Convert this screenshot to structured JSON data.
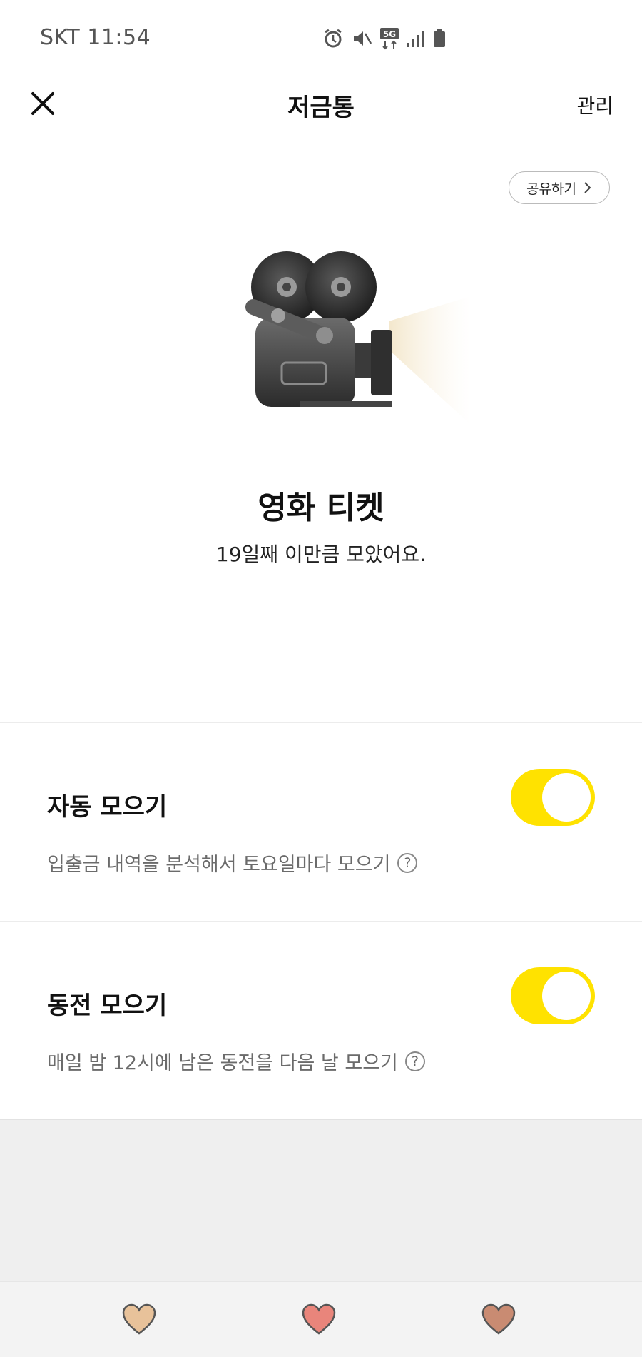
{
  "status_bar": {
    "carrier_time": "SKT 11:54",
    "network": "5G"
  },
  "header": {
    "title": "저금통",
    "manage_label": "관리"
  },
  "share": {
    "label": "공유하기"
  },
  "goal": {
    "name": "영화 티켓",
    "subtitle": "19일째 이만큼 모았어요."
  },
  "settings": [
    {
      "title": "자동 모으기",
      "description": "입출금 내역을 분석해서 토요일마다 모으기",
      "enabled": true
    },
    {
      "title": "동전 모으기",
      "description": "매일 밤 12시에 남은 동전을 다음 날 모으기",
      "enabled": true
    }
  ],
  "colors": {
    "toggle_on": "#ffe200",
    "heart_1": "#e8c29a",
    "heart_2": "#e9857b",
    "heart_3": "#c98b72"
  }
}
